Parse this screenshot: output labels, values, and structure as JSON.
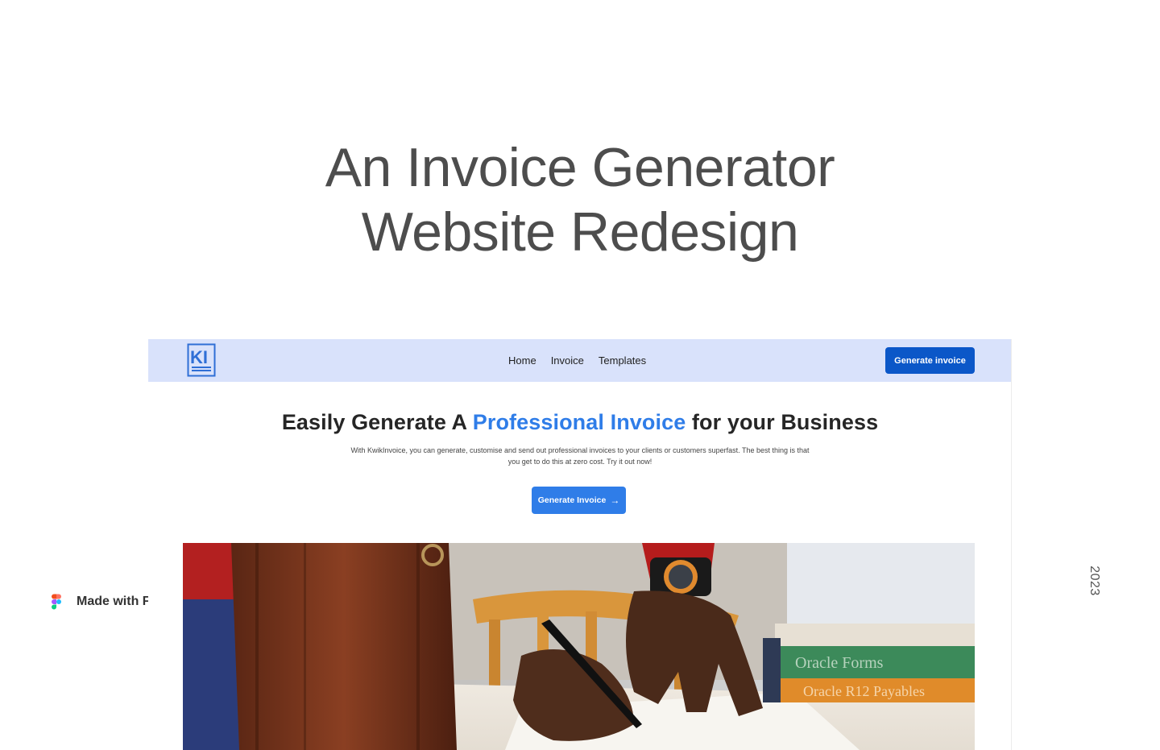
{
  "cover": {
    "title_line1": "An Invoice Generator",
    "title_line2": "Website Redesign",
    "made_with": "Made with Figma",
    "year": "2023"
  },
  "site": {
    "logo_text": "KI",
    "nav": {
      "links": [
        "Home",
        "Invoice",
        "Templates"
      ],
      "cta_label": "Generate invoice"
    },
    "hero": {
      "title_prefix": "Easily Generate A ",
      "title_accent": "Professional Invoice",
      "title_suffix": " for your Business",
      "subtitle": "With KwikInvoice, you can generate, customise and send out professional invoices to your clients or customers superfast. The best thing is that you get to do this at zero cost. Try it out now!",
      "cta_label": "Generate Invoice",
      "cta_icon": "arrow-right-icon"
    },
    "image": {
      "subject": "photo-person-signing-document",
      "book_labels": [
        "Oracle Forms",
        "Oracle R12 Payables"
      ]
    }
  },
  "colors": {
    "nav_bg": "#d9e2fb",
    "primary_dark": "#0b57c8",
    "accent": "#2f7de8",
    "cover_text": "#4d4d4d"
  }
}
